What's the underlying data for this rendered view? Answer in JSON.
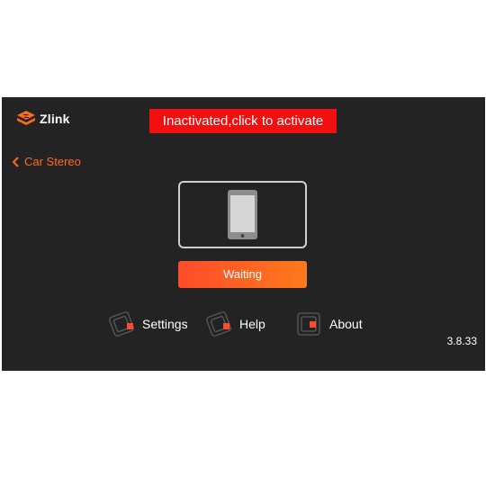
{
  "app": {
    "logo_text": "Zlink",
    "activate_banner": "Inactivated,click to activate",
    "back_label": "Car Stereo",
    "status_button": "Waiting",
    "version": "3.8.33"
  },
  "menu": {
    "settings": "Settings",
    "help": "Help",
    "about": "About"
  },
  "colors": {
    "background": "#232323",
    "accent": "#ff6a22",
    "banner": "#f20f0f"
  },
  "icons": {
    "logo": "zlink-logo-icon",
    "back": "chevron-left-icon",
    "device": "phone-icon",
    "settings": "settings-icon",
    "help": "help-icon",
    "about": "about-icon"
  }
}
